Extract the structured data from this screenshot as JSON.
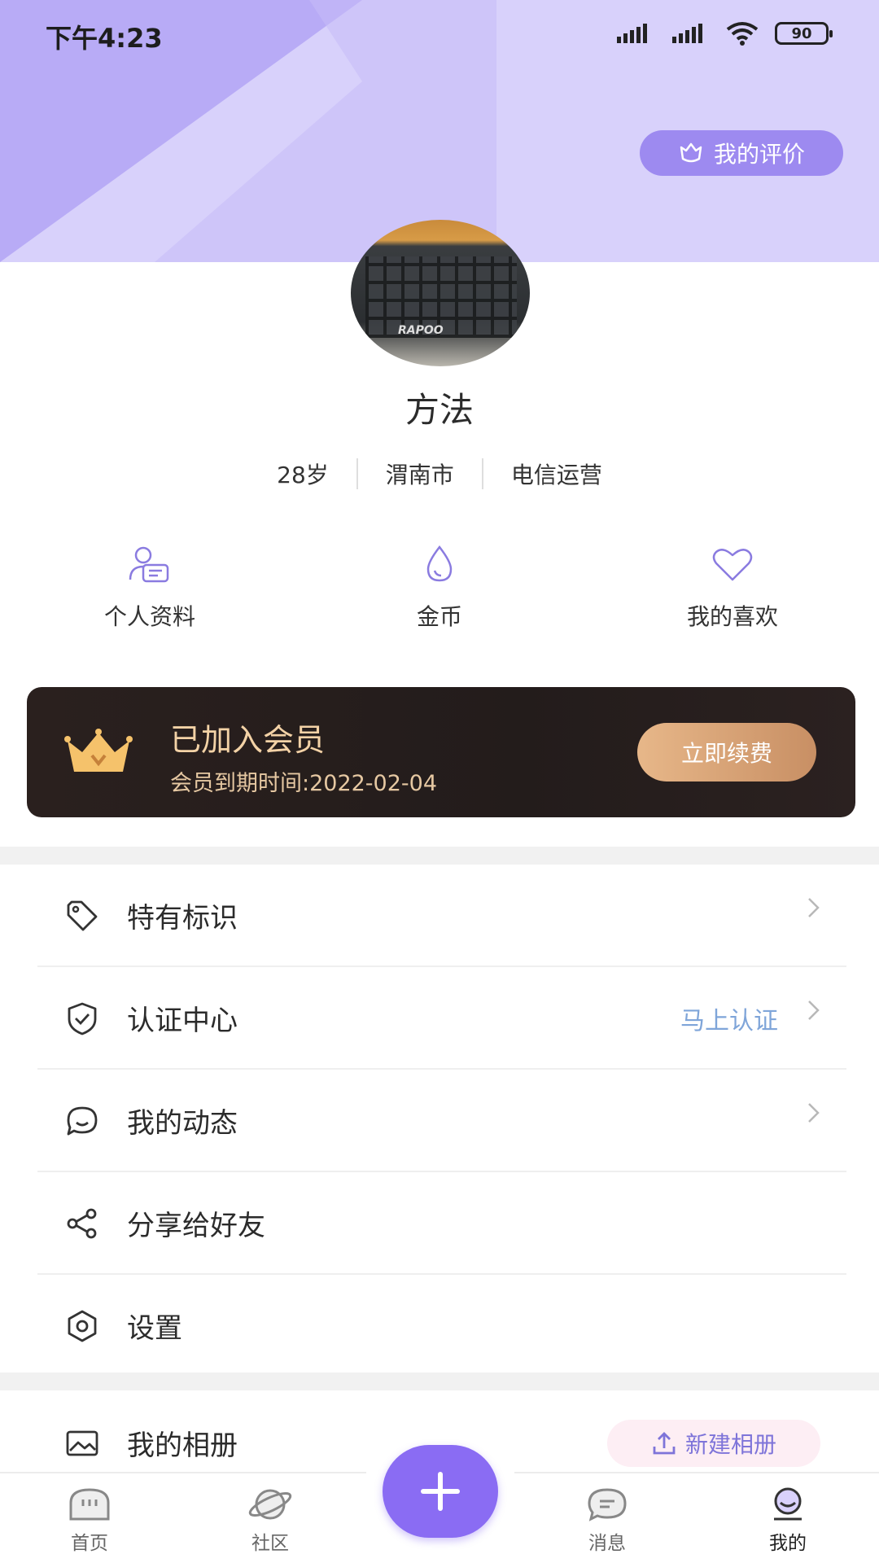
{
  "status_bar": {
    "time": "下午4:23",
    "battery": "90"
  },
  "header": {
    "rate_button": "我的评价"
  },
  "profile": {
    "name": "方法",
    "tags": [
      "28岁",
      "渭南市",
      "电信运营"
    ],
    "avatar_brand": "RAPOO"
  },
  "quick_actions": [
    {
      "label": "个人资料",
      "icon": "profile-card-icon"
    },
    {
      "label": "金币",
      "icon": "drop-icon"
    },
    {
      "label": "我的喜欢",
      "icon": "heart-icon"
    }
  ],
  "vip": {
    "title": "已加入会员",
    "expire": "会员到期时间:2022-02-04",
    "renew_button": "立即续费"
  },
  "menu": [
    {
      "label": "特有标识",
      "icon": "tag-icon",
      "right": ""
    },
    {
      "label": "认证中心",
      "icon": "shield-check-icon",
      "right": "马上认证"
    },
    {
      "label": "我的动态",
      "icon": "chat-bubble-icon",
      "right": ""
    },
    {
      "label": "分享给好友",
      "icon": "share-icon",
      "right": ""
    },
    {
      "label": "设置",
      "icon": "settings-icon",
      "right": ""
    }
  ],
  "album": {
    "label": "我的相册",
    "new_button": "新建相册"
  },
  "tabbar": [
    {
      "label": "首页",
      "icon": "home-icon"
    },
    {
      "label": "社区",
      "icon": "planet-icon"
    },
    {
      "label": "消息",
      "icon": "message-icon"
    },
    {
      "label": "我的",
      "icon": "profile-icon",
      "active": true
    }
  ],
  "colors": {
    "accent": "#8a6cf3",
    "header_bg": "#d8d1fb",
    "link_blue": "#7fa5d9",
    "vip_gold": "#f3d2a6"
  }
}
